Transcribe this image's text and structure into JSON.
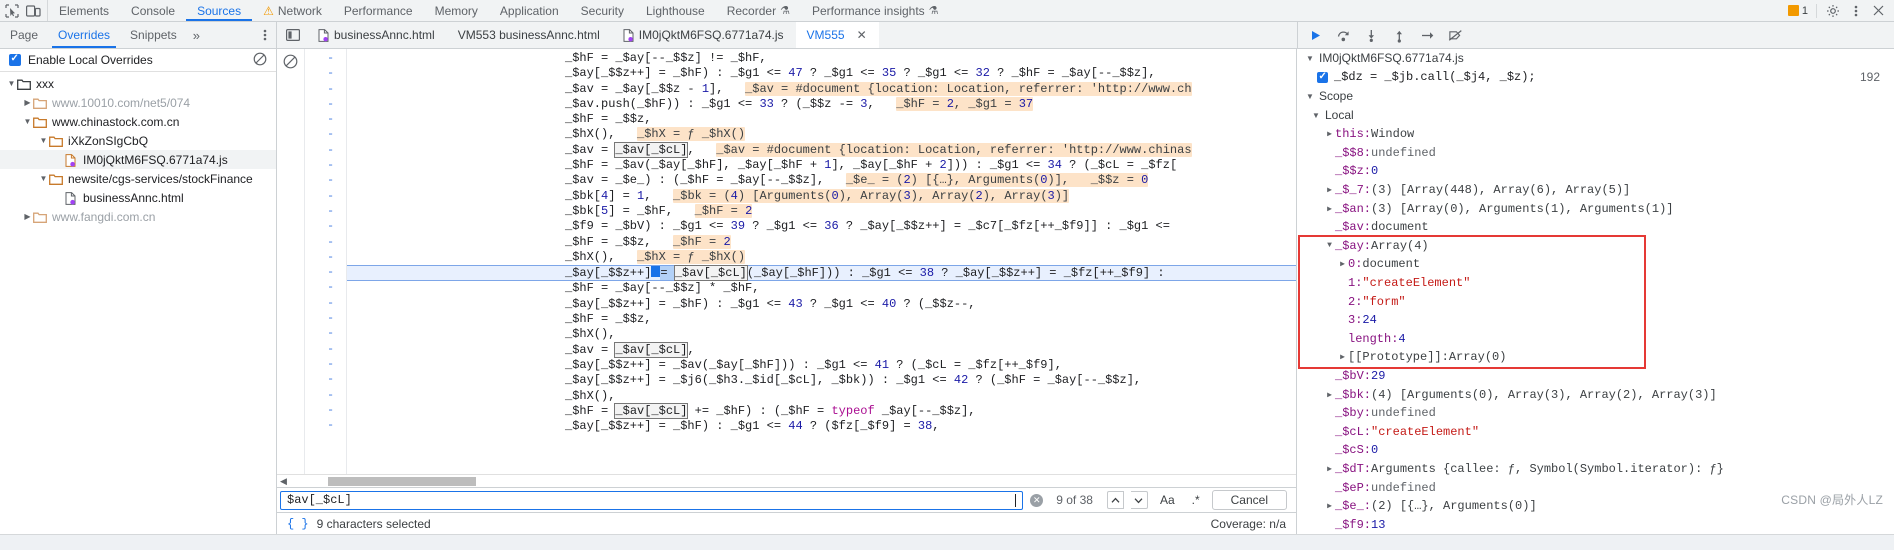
{
  "main_tabs": [
    {
      "label": "Elements",
      "active": false,
      "warn": false
    },
    {
      "label": "Console",
      "active": false,
      "warn": false
    },
    {
      "label": "Sources",
      "active": true,
      "warn": false
    },
    {
      "label": "Network",
      "active": false,
      "warn": true
    },
    {
      "label": "Performance",
      "active": false,
      "warn": false
    },
    {
      "label": "Memory",
      "active": false,
      "warn": false
    },
    {
      "label": "Application",
      "active": false,
      "warn": false
    },
    {
      "label": "Security",
      "active": false,
      "warn": false
    },
    {
      "label": "Lighthouse",
      "active": false,
      "warn": false
    },
    {
      "label": "Recorder",
      "active": false,
      "warn": false,
      "flask": true
    },
    {
      "label": "Performance insights",
      "active": false,
      "warn": false,
      "flask": true
    }
  ],
  "main_toolbar": {
    "inspect_icon": "inspect-element-icon",
    "device_icon": "device-toolbar-icon",
    "error_count": "1",
    "settings_icon": "gear-icon",
    "more_icon": "kebab-menu-icon",
    "close_icon": "close-icon"
  },
  "navigator": {
    "tabs": [
      {
        "label": "Page",
        "active": false
      },
      {
        "label": "Overrides",
        "active": true
      },
      {
        "label": "Snippets",
        "active": false
      }
    ],
    "more_tabs_icon": "chevron-double-right-icon",
    "kebab_icon": "kebab-menu-icon",
    "enable_overrides_label": "Enable Local Overrides",
    "enable_overrides_checked": true,
    "clear_icon": "clear-overrides-icon",
    "tree": [
      {
        "label": "xxx",
        "depth": 0,
        "twisty": "down",
        "type": "folder-root",
        "dim": false,
        "selected": false
      },
      {
        "label": "www.10010.com/net5/074",
        "depth": 1,
        "twisty": "right",
        "type": "folder-dim",
        "dim": true,
        "selected": false
      },
      {
        "label": "www.chinastock.com.cn",
        "depth": 1,
        "twisty": "down",
        "type": "folder",
        "dim": false,
        "selected": false
      },
      {
        "label": "iXkZonSIgCbQ",
        "depth": 2,
        "twisty": "down",
        "type": "folder",
        "dim": false,
        "selected": false
      },
      {
        "label": "IM0jQktM6FSQ.6771a74.js",
        "depth": 3,
        "twisty": "none",
        "type": "file-js",
        "dim": false,
        "selected": true
      },
      {
        "label": "newsite/cgs-services/stockFinance",
        "depth": 2,
        "twisty": "down",
        "type": "folder",
        "dim": false,
        "selected": false
      },
      {
        "label": "businessAnnc.html",
        "depth": 3,
        "twisty": "none",
        "type": "file-html",
        "dim": false,
        "selected": false
      },
      {
        "label": "www.fangdi.com.cn",
        "depth": 1,
        "twisty": "right",
        "type": "folder-dim",
        "dim": true,
        "selected": false
      }
    ]
  },
  "editor_tabs": {
    "panel_toggle_icon": "show-navigator-icon",
    "tabs": [
      {
        "label": "businessAnnc.html",
        "icon": "file-html-icon",
        "active": false,
        "closable": false
      },
      {
        "label": "VM553 businessAnnc.html",
        "icon": "none",
        "active": false,
        "closable": false
      },
      {
        "label": "IM0jQktM6FSQ.6771a74.js",
        "icon": "file-js-icon",
        "active": false,
        "closable": false
      },
      {
        "label": "VM555",
        "icon": "none",
        "active": true,
        "closable": true
      }
    ],
    "close_label": "✕"
  },
  "debugger_toolbar": {
    "resume_icon": "resume-script-icon",
    "step_over_icon": "step-over-icon",
    "step_into_icon": "step-into-icon",
    "step_out_icon": "step-out-icon",
    "step_icon": "step-icon",
    "deactivate_breakpoints_icon": "deactivate-breakpoints-icon"
  },
  "editor": {
    "breakpoint_disabled_icon": "breakpoints-deactivated-icon",
    "gutter_marker": "-",
    "lines": [
      {
        "n": "-",
        "text": "_$hF = _$ay[--_$$z] != _$hF,"
      },
      {
        "n": "-",
        "text": "_$ay[_$$z++] = _$hF) : _$g1 <= 47 ? _$g1 <= 35 ? _$g1 <= 32 ? _$hF = _$ay[--_$$z],"
      },
      {
        "n": "-",
        "text": "_$av = _$ay[_$$z - 1],   _$av = #document {location: Location, referrer: 'http://www.ch"
      },
      {
        "n": "-",
        "text": "_$av.push(_$hF)) : _$g1 <= 33 ? (_$$z -= 3,   _$hF = 2, _$g1 = 37"
      },
      {
        "n": "-",
        "text": "_$hF = _$$z,"
      },
      {
        "n": "-",
        "text": "_$hX(),   _$hX = ƒ _$hX()"
      },
      {
        "n": "-",
        "text": "_$av = _$av[_$cL],   _$av = #document {location: Location, referrer: 'http://www.chinas"
      },
      {
        "n": "-",
        "text": "_$hF = _$av(_$ay[_$hF], _$ay[_$hF + 1], _$ay[_$hF + 2])) : _$g1 <= 34 ? (_$cL = _$fz["
      },
      {
        "n": "-",
        "text": "_$av = _$e_) : (_$hF = _$ay[--_$$z],   _$e_ = (2) [{…}, Arguments(0)],   _$$z = 0"
      },
      {
        "n": "-",
        "text": "_$bk[4] = 1,   _$bk = (4) [Arguments(0), Array(3), Array(2), Array(3)]"
      },
      {
        "n": "-",
        "text": "_$bk[5] = _$hF,   _$hF = 2"
      },
      {
        "n": "-",
        "text": "_$f9 = _$bV) : _$g1 <= 39 ? _$g1 <= 36 ? _$ay[_$$z++] = _$c7[_$fz[++_$f9]] : _$g1 <= "
      },
      {
        "n": "-",
        "text": "_$hF = _$$z,   _$hF = 2"
      },
      {
        "n": "-",
        "text": "_$hX(),   _$hX = ƒ _$hX()"
      },
      {
        "n": "-",
        "text": "_$ay[_$$z++]  = _$av[_$cL](_$ay[_$hF])) : _$g1 <= 38 ? _$ay[_$$z++] = _$fz[++_$f9] :",
        "highlight": true
      },
      {
        "n": "-",
        "text": "_$hF = _$ay[--_$$z] * _$hF,"
      },
      {
        "n": "-",
        "text": "_$ay[_$$z++] = _$hF) : _$g1 <= 43 ? _$g1 <= 40 ? (_$$z--,"
      },
      {
        "n": "-",
        "text": "_$hF = _$$z,"
      },
      {
        "n": "-",
        "text": "_$hX(),"
      },
      {
        "n": "-",
        "text": "_$av = _$av[_$cL],"
      },
      {
        "n": "-",
        "text": "_$ay[_$$z++] = _$av(_$ay[_$hF])) : _$g1 <= 41 ? (_$cL = _$fz[++_$f9],"
      },
      {
        "n": "-",
        "text": "_$ay[_$$z++] = _$j6(_$h3._$id[_$cL], _$bk)) : _$g1 <= 42 ? (_$hF = _$ay[--_$$z],"
      },
      {
        "n": "-",
        "text": "_$hX(),"
      },
      {
        "n": "-",
        "text": "_$hF = _$av[_$cL] += _$hF) : (_$hF = typeof _$ay[--_$$z],"
      },
      {
        "n": "-",
        "text": "_$ay[_$$z++] = _$hF) : _$g1 <= 44 ? ($fz[_$f9] = 38,"
      }
    ],
    "hscroll_icon": "scroll-left-arrow"
  },
  "search": {
    "value": "$av[_$cL]",
    "clear_icon": "clear-search-icon",
    "match_count": "9 of 38",
    "prev_icon": "chevron-up-icon",
    "next_icon": "chevron-down-icon",
    "match_case_label": "Aa",
    "regex_label": ".*",
    "cancel_label": "Cancel"
  },
  "status": {
    "format_icon": "pretty-print-braces-icon",
    "selection_text": "9 characters selected",
    "coverage_text": "Coverage: n/a"
  },
  "debugger": {
    "call_stack": {
      "file_label": "IM0jQktM6FSQ.6771a74.js",
      "frame_checked": true,
      "frame_code": "_$dz = _$jb.call(_$j4, _$z);",
      "frame_line": "192"
    },
    "scope_label": "Scope",
    "local_label": "Local",
    "variables": [
      {
        "indent": 1,
        "twisty": "right",
        "name": "this:",
        "value": " Window",
        "vclass": "obj"
      },
      {
        "indent": 1,
        "twisty": "none",
        "name": "_$$8:",
        "value": " undefined",
        "vclass": "dim"
      },
      {
        "indent": 1,
        "twisty": "none",
        "name": "_$$z:",
        "value": " 0",
        "vclass": "num"
      },
      {
        "indent": 1,
        "twisty": "right",
        "name": "_$_7:",
        "value": " (3) [Array(448), Array(6), Array(5)]",
        "vclass": "obj"
      },
      {
        "indent": 1,
        "twisty": "right",
        "name": "_$an:",
        "value": " (3) [Array(0), Arguments(1), Arguments(1)]",
        "vclass": "obj"
      },
      {
        "indent": 1,
        "twisty": "none",
        "name": "_$av:",
        "value": " document",
        "vclass": "obj"
      },
      {
        "indent": 1,
        "twisty": "down",
        "name": "_$ay:",
        "value": " Array(4)",
        "vclass": "obj"
      },
      {
        "indent": 2,
        "twisty": "right",
        "name": "0:",
        "value": " document",
        "vclass": "obj"
      },
      {
        "indent": 2,
        "twisty": "none",
        "name": "1:",
        "value": " \"createElement\"",
        "vclass": "str"
      },
      {
        "indent": 2,
        "twisty": "none",
        "name": "2:",
        "value": " \"form\"",
        "vclass": "str"
      },
      {
        "indent": 2,
        "twisty": "none",
        "name": "3:",
        "value": " 24",
        "vclass": "num"
      },
      {
        "indent": 2,
        "twisty": "none",
        "name": "length:",
        "value": " 4",
        "vclass": "num"
      },
      {
        "indent": 2,
        "twisty": "right",
        "name": "[[Prototype]]:",
        "value": " Array(0)",
        "vclass": "obj",
        "nameplain": true
      },
      {
        "indent": 1,
        "twisty": "none",
        "name": "_$bV:",
        "value": " 29",
        "vclass": "num"
      },
      {
        "indent": 1,
        "twisty": "right",
        "name": "_$bk:",
        "value": " (4) [Arguments(0), Array(3), Array(2), Array(3)]",
        "vclass": "obj"
      },
      {
        "indent": 1,
        "twisty": "none",
        "name": "_$by:",
        "value": " undefined",
        "vclass": "dim"
      },
      {
        "indent": 1,
        "twisty": "none",
        "name": "_$cL:",
        "value": " \"createElement\"",
        "vclass": "str"
      },
      {
        "indent": 1,
        "twisty": "none",
        "name": "_$cS:",
        "value": " 0",
        "vclass": "num"
      },
      {
        "indent": 1,
        "twisty": "right",
        "name": "_$dT:",
        "value": " Arguments {callee: ƒ, Symbol(Symbol.iterator): ƒ}",
        "vclass": "obj"
      },
      {
        "indent": 1,
        "twisty": "none",
        "name": "_$eP:",
        "value": " undefined",
        "vclass": "dim"
      },
      {
        "indent": 1,
        "twisty": "right",
        "name": "_$e_:",
        "value": " (2) [{…}, Arguments(0)]",
        "vclass": "obj"
      },
      {
        "indent": 1,
        "twisty": "none",
        "name": "_$f9:",
        "value": " 13",
        "vclass": "num"
      }
    ]
  },
  "watermark": "CSDN @局外人LZ",
  "colors": {
    "accent": "#1a73e8",
    "warn": "#f29900",
    "string": "#c41a16",
    "number": "#1a1aa6",
    "property": "#881280",
    "inline_value_bg": "#fde3c8",
    "highlight_line": "#e8f0fe",
    "redbox": "#e53935"
  }
}
